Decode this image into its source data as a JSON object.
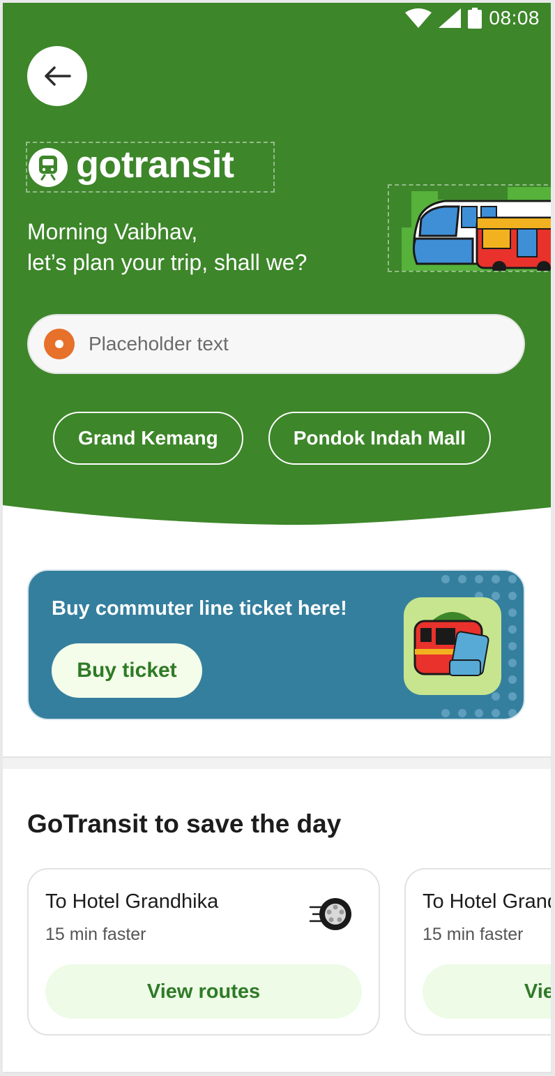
{
  "status_bar": {
    "time": "08:08"
  },
  "header": {
    "logo_text": "gotransit",
    "greeting_line1": "Morning Vaibhav,",
    "greeting_line2": "let’s plan your trip, shall we?",
    "bg_color": "#3d862a"
  },
  "search": {
    "placeholder": "Placeholder text"
  },
  "quick_destinations": [
    {
      "label": "Grand Kemang"
    },
    {
      "label": "Pondok Indah Mall"
    }
  ],
  "promo_banner": {
    "title": "Buy commuter line ticket here!",
    "button_label": "Buy ticket",
    "bg_color": "#357f9e"
  },
  "section": {
    "title": "GoTransit to save the day",
    "cards": [
      {
        "title": "To Hotel Grandhika",
        "subtitle": "15 min faster",
        "button_label": "View routes",
        "icon": "wheel-icon"
      },
      {
        "title": "To Hotel Grandhika",
        "subtitle": "15 min faster",
        "button_label": "View routes"
      }
    ]
  },
  "icons": {
    "back": "arrow-left-icon",
    "logo": "train-icon",
    "search_origin": "origin-dot-icon"
  }
}
